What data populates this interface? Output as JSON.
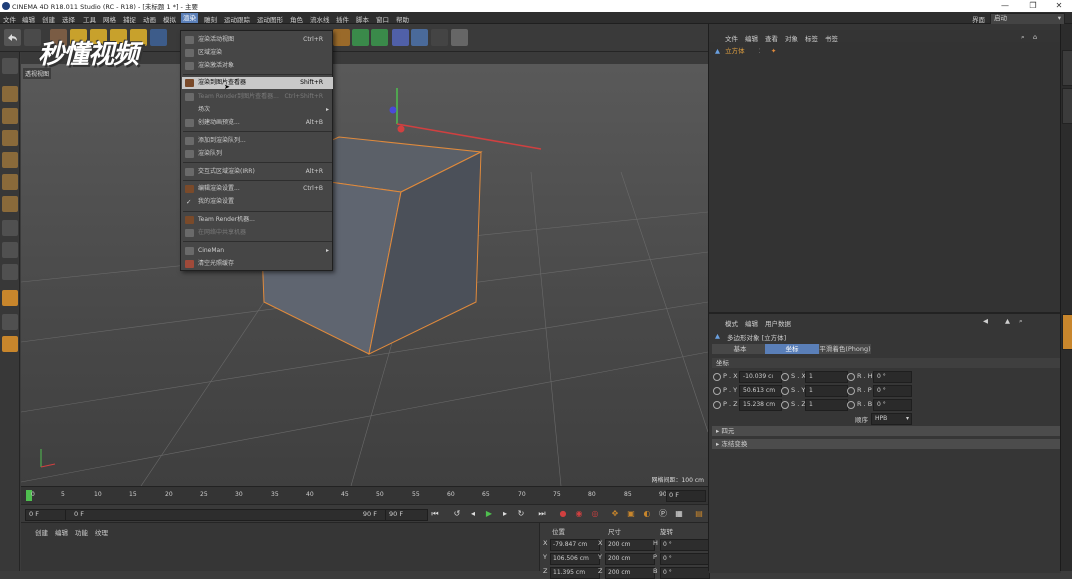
{
  "window": {
    "title": "CINEMA 4D R18.011 Studio (RC - R18) - [未标题 1 *] - 主要",
    "min": "—",
    "max": "❐",
    "close": "✕"
  },
  "menubar": {
    "items": [
      "文件",
      "编辑",
      "创建",
      "选择",
      "工具",
      "网格",
      "捕捉",
      "动画",
      "模拟",
      "渲染",
      "雕刻",
      "运动跟踪",
      "运动图形",
      "角色",
      "流水线",
      "插件",
      "脚本",
      "窗口",
      "帮助"
    ],
    "active_index": 9,
    "layout_label": "界面",
    "layout_value": "启动"
  },
  "watermark": "秒懂视频",
  "viewport": {
    "tag": "透视视图",
    "grid_spacing": "网格间距：100 cm"
  },
  "render_menu": {
    "items": [
      {
        "label": "渲染活动视图",
        "shortcut": "Ctrl+R"
      },
      {
        "label": "区域渲染",
        "shortcut": ""
      },
      {
        "label": "渲染激活对象",
        "shortcut": ""
      },
      {
        "label": "渲染到图片查看器",
        "shortcut": "Shift+R"
      },
      {
        "label": "Team Render到图片查看器...",
        "shortcut": "Ctrl+Shift+R"
      },
      {
        "label": "场次",
        "shortcut": ""
      },
      {
        "label": "创建动画预览...",
        "shortcut": "Alt+B"
      },
      {
        "label": "添加到渲染队列...",
        "shortcut": ""
      },
      {
        "label": "渲染队列",
        "shortcut": ""
      },
      {
        "label": "交互式区域渲染(IRR)",
        "shortcut": "Alt+R"
      },
      {
        "label": "编辑渲染设置...",
        "shortcut": "Ctrl+B"
      },
      {
        "label": "我的渲染设置",
        "shortcut": ""
      },
      {
        "label": "Team Render机器...",
        "shortcut": ""
      },
      {
        "label": "在网络中共享机器",
        "shortcut": ""
      },
      {
        "label": "CineMan",
        "shortcut": ""
      },
      {
        "label": "清空光照缓存",
        "shortcut": ""
      }
    ]
  },
  "timeline": {
    "ticks": [
      "0",
      "5",
      "10",
      "15",
      "20",
      "25",
      "30",
      "35",
      "40",
      "45",
      "50",
      "55",
      "60",
      "65",
      "70",
      "75",
      "80",
      "85",
      "90"
    ],
    "current": "0 F"
  },
  "transport": {
    "start": "0 F",
    "slider_start": "0 F",
    "slider_end": "90 F",
    "end": "90 F"
  },
  "material_panel": {
    "menus": [
      "创建",
      "编辑",
      "功能",
      "纹理"
    ]
  },
  "coordinates": {
    "headers": [
      "位置",
      "尺寸",
      "旋转"
    ],
    "rows": [
      {
        "axis": "X",
        "pos": "-79.847 cm",
        "size": "200 cm",
        "rot_axis": "H",
        "rot": "0 °"
      },
      {
        "axis": "Y",
        "pos": "106.506 cm",
        "size": "200 cm",
        "rot_axis": "P",
        "rot": "0 °"
      },
      {
        "axis": "Z",
        "pos": "11.395 cm",
        "size": "200 cm",
        "rot_axis": "B",
        "rot": "0 °"
      }
    ]
  },
  "object_manager": {
    "menus": [
      "文件",
      "编辑",
      "查看",
      "对象",
      "标签",
      "书签"
    ],
    "object_name": "立方体"
  },
  "attributes": {
    "menus": [
      "模式",
      "编辑",
      "用户数据"
    ],
    "object_title": "多边形对象 [立方体]",
    "tabs": [
      "基本",
      "坐标",
      "平滑着色(Phong)"
    ],
    "active_tab": 1,
    "section": "坐标",
    "rows": [
      {
        "p_label": "P . X",
        "p": "-10.039 cı",
        "s_label": "S . X",
        "s": "1",
        "r_label": "R . H",
        "r": "0 °"
      },
      {
        "p_label": "P . Y",
        "p": "50.613 cm",
        "s_label": "S . Y",
        "s": "1",
        "r_label": "R . P",
        "r": "0 °"
      },
      {
        "p_label": "P . Z",
        "p": "15.238 cm",
        "s_label": "S . Z",
        "s": "1",
        "r_label": "R . B",
        "r": "0 °"
      }
    ],
    "order_label": "顺序",
    "order_value": "HPB",
    "collapsed_sections": [
      "四元",
      "冻结变换"
    ]
  },
  "colors": {
    "accent": "#5a7fb8",
    "cube_edge": "#e08a3c",
    "timeline_frame": "#4fbf4f"
  }
}
